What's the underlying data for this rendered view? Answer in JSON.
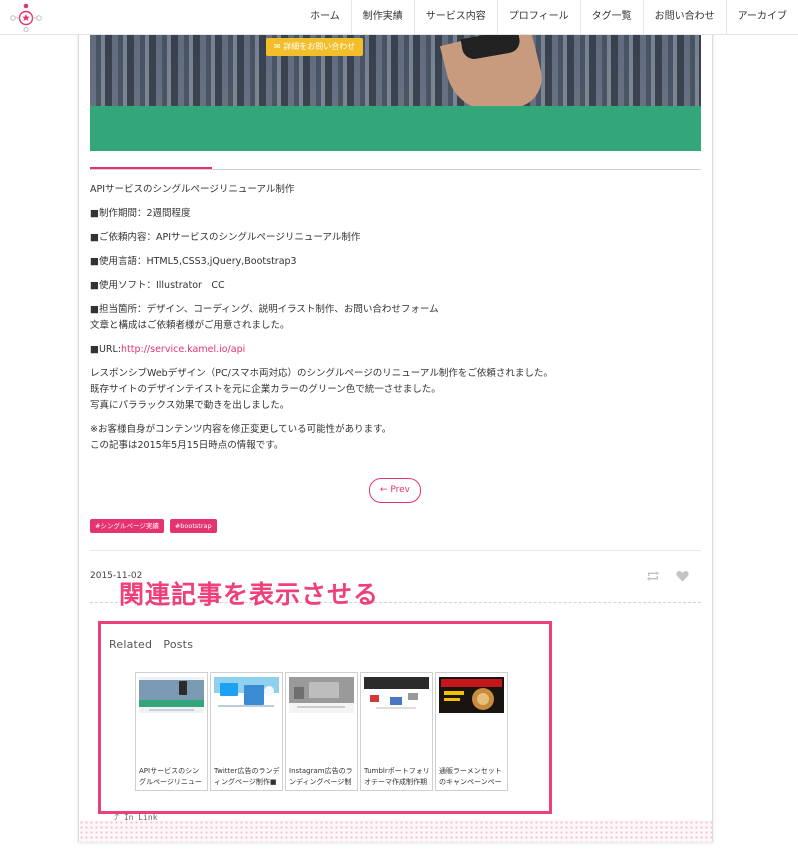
{
  "header": {
    "nav": [
      "ホーム",
      "制作実績",
      "サービス内容",
      "プロフィール",
      "タグ一覧",
      "お問い合わせ",
      "アーカイブ"
    ]
  },
  "hero": {
    "button_label": "詳細をお問い合わせ"
  },
  "article": {
    "paragraphs": [
      [
        "APIサービスのシングルページリニューアル制作"
      ],
      [
        "■制作期間：2週間程度"
      ],
      [
        "■ご依頼内容：APIサービスのシングルページリニューアル制作"
      ],
      [
        "■使用言語：HTML5,CSS3,jQuery,Bootstrap3"
      ],
      [
        "■使用ソフト：Illustrator　CC"
      ],
      [
        "■担当箇所：デザイン、コーディング、説明イラスト制作、お問い合わせフォーム",
        "文章と構成はご依頼者様がご用意されました。"
      ],
      [
        "■URL:"
      ],
      [
        "レスポンシブWebデザイン（PC/スマホ両対応）のシングルページのリニューアル制作をご依頼されました。",
        "既存サイトのデザインテイストを元に企業カラーのグリーン色で統一させました。",
        "写真にパララックス効果で動きを出しました。"
      ],
      [
        "※お客様自身がコンテンツ内容を修正変更している可能性があります。",
        "この記事は2015年5月15日時点の情報です。"
      ]
    ],
    "url_text": "http://service.kamel.io/api"
  },
  "pagination": {
    "prev_label": "Prev"
  },
  "tags": [
    "#シングルページ実績",
    "#bootstrap"
  ],
  "meta": {
    "date": "2015-11-02"
  },
  "annotation": {
    "text": "関連記事を表示させる",
    "color": "#ef3f79"
  },
  "related": {
    "title": "Related　Posts",
    "posts": [
      {
        "caption": "APIサービスのシングルページリニューアル制",
        "thumb": "green-site"
      },
      {
        "caption": "Twitter広告のランディングページ制作■制",
        "thumb": "blue-site"
      },
      {
        "caption": "Instagram広告のランディングページ制作■",
        "thumb": "gray-site"
      },
      {
        "caption": "Tumblrポートフォリオテーマ作成制作期",
        "thumb": "dark-portfolio"
      },
      {
        "caption": "通販ラーメンセットのキャンペーンページ制",
        "thumb": "ramen"
      }
    ]
  },
  "footer": {
    "link_label": "In Link"
  },
  "colors": {
    "accent": "#e5336f",
    "green": "#33a67a",
    "hero_button": "#f2bf2b"
  }
}
